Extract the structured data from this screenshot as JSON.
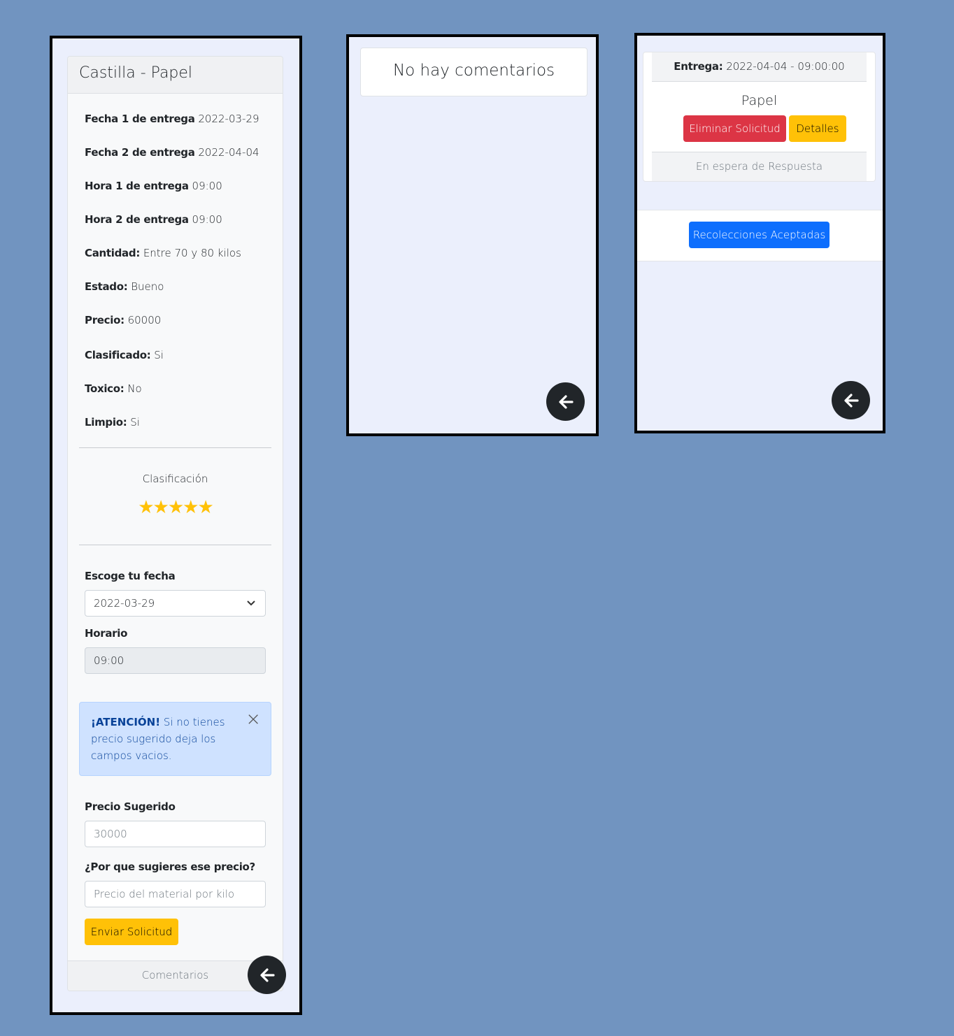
{
  "colors": {
    "background": "#7194c0",
    "phone_bg": "#ebeffc",
    "warning": "#ffc107",
    "danger": "#dc3545",
    "primary": "#0d6efd",
    "alert_bg": "#cfe2ff",
    "alert_text": "#084298",
    "back_button": "#212529"
  },
  "screen1": {
    "title": "Castilla - Papel",
    "details": [
      {
        "label": "Fecha 1 de entrega",
        "value": "2022-03-29"
      },
      {
        "label": "Fecha 2 de entrega",
        "value": "2022-04-04"
      },
      {
        "label": "Hora 1 de entrega",
        "value": "09:00"
      },
      {
        "label": "Hora 2 de entrega",
        "value": "09:00"
      },
      {
        "label": "Cantidad:",
        "value": "Entre 70 y 80 kilos"
      },
      {
        "label": "Estado:",
        "value": "Bueno"
      },
      {
        "label": "Precio:",
        "value": "60000"
      },
      {
        "label": "Clasificado:",
        "value": "Si"
      },
      {
        "label": "Toxico:",
        "value": "No"
      },
      {
        "label": "Limpio:",
        "value": "Si"
      }
    ],
    "rating_label": "Clasificación",
    "rating_stars": "★★★★★",
    "rating_value": 5,
    "date_label": "Escoge tu fecha",
    "date_selected": "2022-03-29",
    "schedule_label": "Horario",
    "schedule_value": "09:00",
    "alert_strong": "¡ATENCIÓN!",
    "alert_text": "Si no tienes precio sugerido deja los campos vacios.",
    "alert_close": "×",
    "price_label": "Precio Sugerido",
    "price_placeholder": "30000",
    "reason_label": "¿Por que sugieres ese precio?",
    "reason_placeholder": "Precio del material por kilo",
    "submit_label": "Enviar Solicitud",
    "footer": "Comentarios",
    "back_icon": "arrow-left-icon"
  },
  "screen2": {
    "message": "No hay comentarios",
    "back_icon": "arrow-left-icon"
  },
  "screen3": {
    "delivery_label": "Entrega:",
    "delivery_value": "2022-04-04 - 09:00:00",
    "material": "Papel",
    "delete_label": "Eliminar Solicitud",
    "details_label": "Detalles",
    "status": "En espera de Respuesta",
    "accepted_label": "Recolecciones Aceptadas",
    "back_icon": "arrow-left-icon"
  }
}
